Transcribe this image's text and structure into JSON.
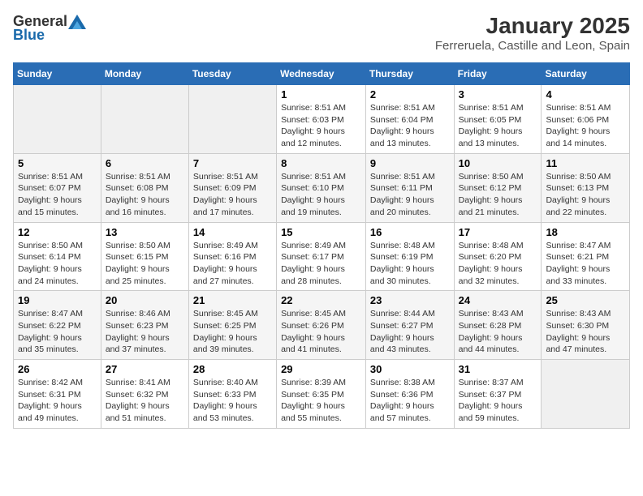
{
  "logo": {
    "general": "General",
    "blue": "Blue"
  },
  "title": "January 2025",
  "subtitle": "Ferreruela, Castille and Leon, Spain",
  "headers": [
    "Sunday",
    "Monday",
    "Tuesday",
    "Wednesday",
    "Thursday",
    "Friday",
    "Saturday"
  ],
  "weeks": [
    [
      {
        "day": "",
        "info": ""
      },
      {
        "day": "",
        "info": ""
      },
      {
        "day": "",
        "info": ""
      },
      {
        "day": "1",
        "info": "Sunrise: 8:51 AM\nSunset: 6:03 PM\nDaylight: 9 hours and 12 minutes."
      },
      {
        "day": "2",
        "info": "Sunrise: 8:51 AM\nSunset: 6:04 PM\nDaylight: 9 hours and 13 minutes."
      },
      {
        "day": "3",
        "info": "Sunrise: 8:51 AM\nSunset: 6:05 PM\nDaylight: 9 hours and 13 minutes."
      },
      {
        "day": "4",
        "info": "Sunrise: 8:51 AM\nSunset: 6:06 PM\nDaylight: 9 hours and 14 minutes."
      }
    ],
    [
      {
        "day": "5",
        "info": "Sunrise: 8:51 AM\nSunset: 6:07 PM\nDaylight: 9 hours and 15 minutes."
      },
      {
        "day": "6",
        "info": "Sunrise: 8:51 AM\nSunset: 6:08 PM\nDaylight: 9 hours and 16 minutes."
      },
      {
        "day": "7",
        "info": "Sunrise: 8:51 AM\nSunset: 6:09 PM\nDaylight: 9 hours and 17 minutes."
      },
      {
        "day": "8",
        "info": "Sunrise: 8:51 AM\nSunset: 6:10 PM\nDaylight: 9 hours and 19 minutes."
      },
      {
        "day": "9",
        "info": "Sunrise: 8:51 AM\nSunset: 6:11 PM\nDaylight: 9 hours and 20 minutes."
      },
      {
        "day": "10",
        "info": "Sunrise: 8:50 AM\nSunset: 6:12 PM\nDaylight: 9 hours and 21 minutes."
      },
      {
        "day": "11",
        "info": "Sunrise: 8:50 AM\nSunset: 6:13 PM\nDaylight: 9 hours and 22 minutes."
      }
    ],
    [
      {
        "day": "12",
        "info": "Sunrise: 8:50 AM\nSunset: 6:14 PM\nDaylight: 9 hours and 24 minutes."
      },
      {
        "day": "13",
        "info": "Sunrise: 8:50 AM\nSunset: 6:15 PM\nDaylight: 9 hours and 25 minutes."
      },
      {
        "day": "14",
        "info": "Sunrise: 8:49 AM\nSunset: 6:16 PM\nDaylight: 9 hours and 27 minutes."
      },
      {
        "day": "15",
        "info": "Sunrise: 8:49 AM\nSunset: 6:17 PM\nDaylight: 9 hours and 28 minutes."
      },
      {
        "day": "16",
        "info": "Sunrise: 8:48 AM\nSunset: 6:19 PM\nDaylight: 9 hours and 30 minutes."
      },
      {
        "day": "17",
        "info": "Sunrise: 8:48 AM\nSunset: 6:20 PM\nDaylight: 9 hours and 32 minutes."
      },
      {
        "day": "18",
        "info": "Sunrise: 8:47 AM\nSunset: 6:21 PM\nDaylight: 9 hours and 33 minutes."
      }
    ],
    [
      {
        "day": "19",
        "info": "Sunrise: 8:47 AM\nSunset: 6:22 PM\nDaylight: 9 hours and 35 minutes."
      },
      {
        "day": "20",
        "info": "Sunrise: 8:46 AM\nSunset: 6:23 PM\nDaylight: 9 hours and 37 minutes."
      },
      {
        "day": "21",
        "info": "Sunrise: 8:45 AM\nSunset: 6:25 PM\nDaylight: 9 hours and 39 minutes."
      },
      {
        "day": "22",
        "info": "Sunrise: 8:45 AM\nSunset: 6:26 PM\nDaylight: 9 hours and 41 minutes."
      },
      {
        "day": "23",
        "info": "Sunrise: 8:44 AM\nSunset: 6:27 PM\nDaylight: 9 hours and 43 minutes."
      },
      {
        "day": "24",
        "info": "Sunrise: 8:43 AM\nSunset: 6:28 PM\nDaylight: 9 hours and 44 minutes."
      },
      {
        "day": "25",
        "info": "Sunrise: 8:43 AM\nSunset: 6:30 PM\nDaylight: 9 hours and 47 minutes."
      }
    ],
    [
      {
        "day": "26",
        "info": "Sunrise: 8:42 AM\nSunset: 6:31 PM\nDaylight: 9 hours and 49 minutes."
      },
      {
        "day": "27",
        "info": "Sunrise: 8:41 AM\nSunset: 6:32 PM\nDaylight: 9 hours and 51 minutes."
      },
      {
        "day": "28",
        "info": "Sunrise: 8:40 AM\nSunset: 6:33 PM\nDaylight: 9 hours and 53 minutes."
      },
      {
        "day": "29",
        "info": "Sunrise: 8:39 AM\nSunset: 6:35 PM\nDaylight: 9 hours and 55 minutes."
      },
      {
        "day": "30",
        "info": "Sunrise: 8:38 AM\nSunset: 6:36 PM\nDaylight: 9 hours and 57 minutes."
      },
      {
        "day": "31",
        "info": "Sunrise: 8:37 AM\nSunset: 6:37 PM\nDaylight: 9 hours and 59 minutes."
      },
      {
        "day": "",
        "info": ""
      }
    ]
  ]
}
